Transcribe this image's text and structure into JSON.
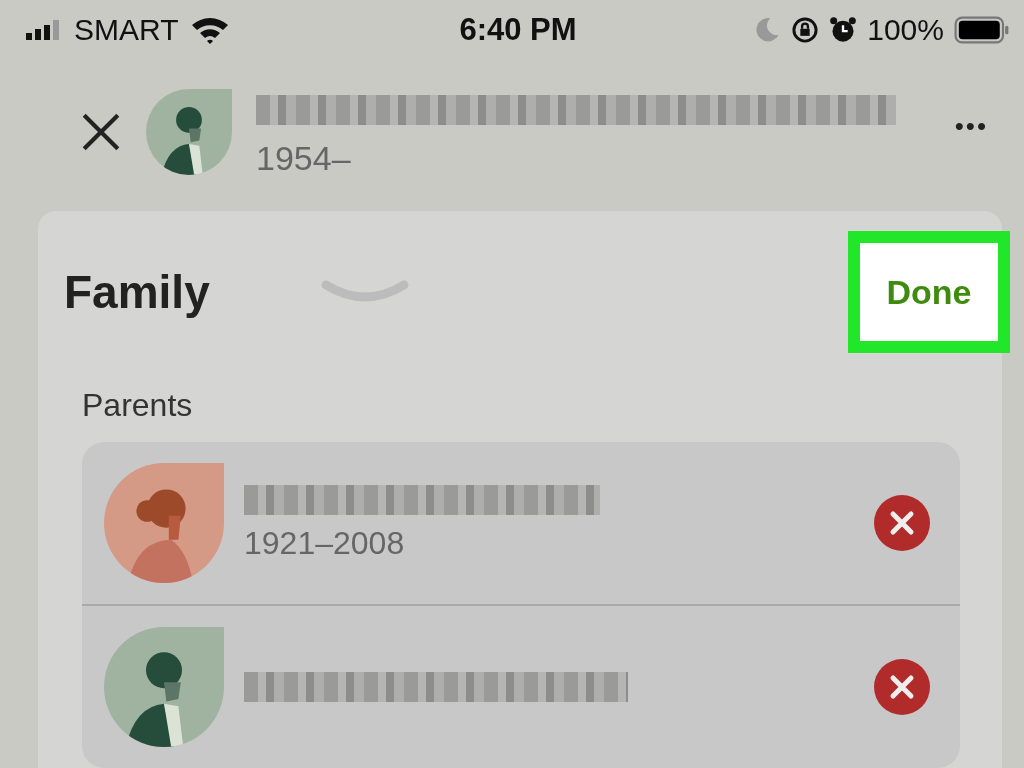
{
  "status_bar": {
    "carrier": "SMART",
    "time": "6:40 PM",
    "battery": "100%"
  },
  "header": {
    "kind": "male",
    "years": "1954–",
    "more": "•••"
  },
  "sheet": {
    "title": "Family",
    "done": "Done",
    "done_highlighted": true
  },
  "parents": {
    "label": "Parents",
    "items": [
      {
        "kind": "female",
        "years": "1921–2008"
      },
      {
        "kind": "male"
      }
    ]
  }
}
